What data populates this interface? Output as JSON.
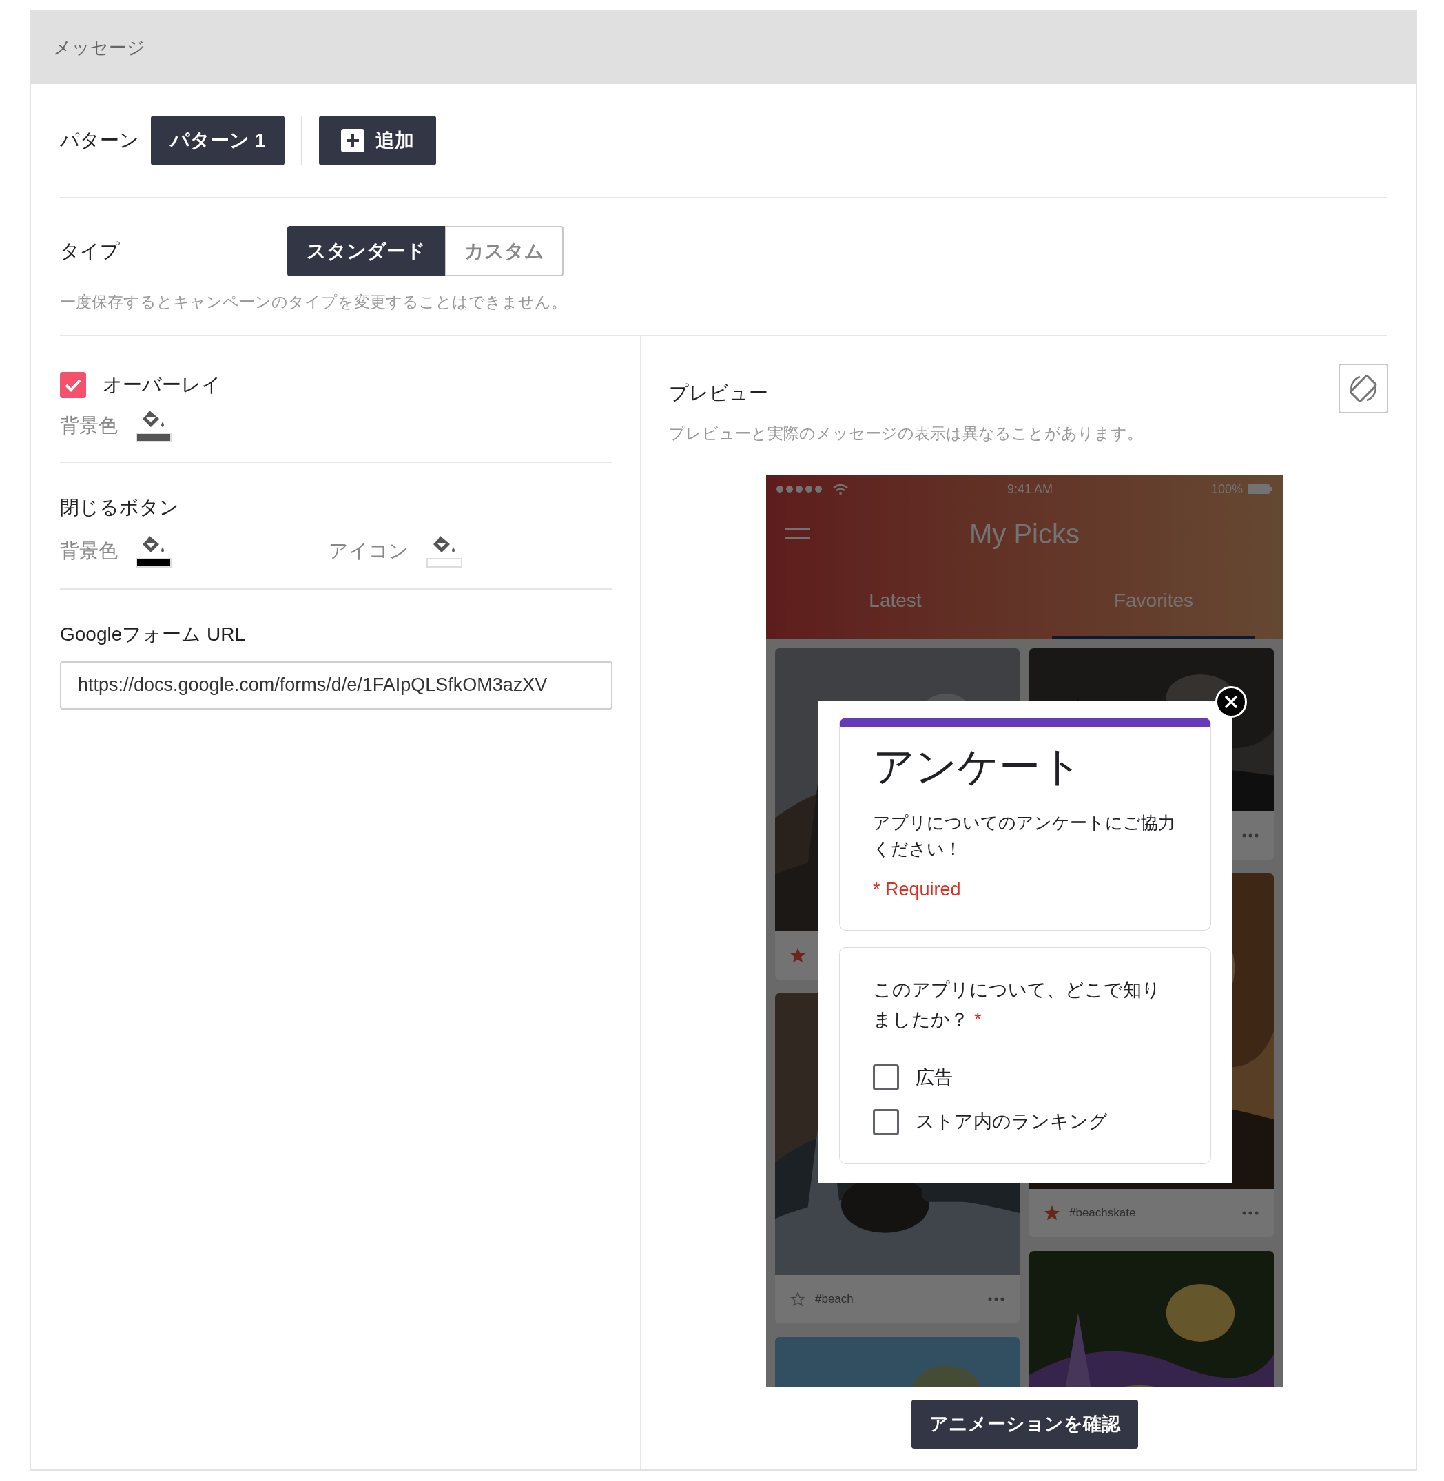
{
  "header": {
    "title": "メッセージ"
  },
  "pattern": {
    "label": "パターン",
    "patterns": [
      {
        "label": "パターン 1",
        "selected": true
      }
    ],
    "add_button": "追加"
  },
  "type": {
    "label": "タイプ",
    "options": [
      {
        "label": "スタンダード",
        "selected": true
      },
      {
        "label": "カスタム",
        "selected": false
      }
    ],
    "note": "一度保存するとキャンペーンのタイプを変更することはできません。"
  },
  "overlay": {
    "label": "オーバーレイ",
    "checked": true,
    "settings": [
      {
        "label": "背景色",
        "color": "#555555"
      }
    ]
  },
  "close_button": {
    "label": "閉じるボタン",
    "settings": [
      {
        "label": "背景色",
        "color": "#000000"
      },
      {
        "label": "アイコン",
        "color": "#ffffff"
      }
    ]
  },
  "form_url": {
    "label": "Googleフォーム URL",
    "value": "https://docs.google.com/forms/d/e/1FAIpQLSfkOM3azXV"
  },
  "preview": {
    "title": "プレビュー",
    "note": "プレビューと実際のメッセージの表示は異なることがあります。",
    "phone": {
      "time": "9:41 AM",
      "battery": "100%",
      "app_title": "My Picks",
      "tabs": [
        {
          "label": "Latest",
          "selected": false
        },
        {
          "label": "Favorites",
          "selected": true
        }
      ],
      "columns": [
        [
          {
            "kind": "picture",
            "starred": true,
            "more": false
          },
          {
            "kind": "picture",
            "starred": false,
            "tag": "#beach",
            "more": true
          },
          {
            "kind": "picture"
          }
        ],
        [
          {
            "kind": "picture",
            "more": true
          },
          {
            "kind": "picture",
            "starred": true,
            "tag": "#beachskate",
            "more": true
          },
          {
            "kind": "picture"
          }
        ]
      ],
      "modal": {
        "title": "アンケート",
        "description": "アプリについてのアンケートにご協力ください！",
        "required_note": "* Required",
        "question": "このアプリについて、どこで知りましたか？",
        "required_mark": "*",
        "options": [
          {
            "label": "広告",
            "checked": false
          },
          {
            "label": "ストア内のランキング",
            "checked": false
          }
        ]
      }
    },
    "animation_button": "アニメーションを確認"
  }
}
